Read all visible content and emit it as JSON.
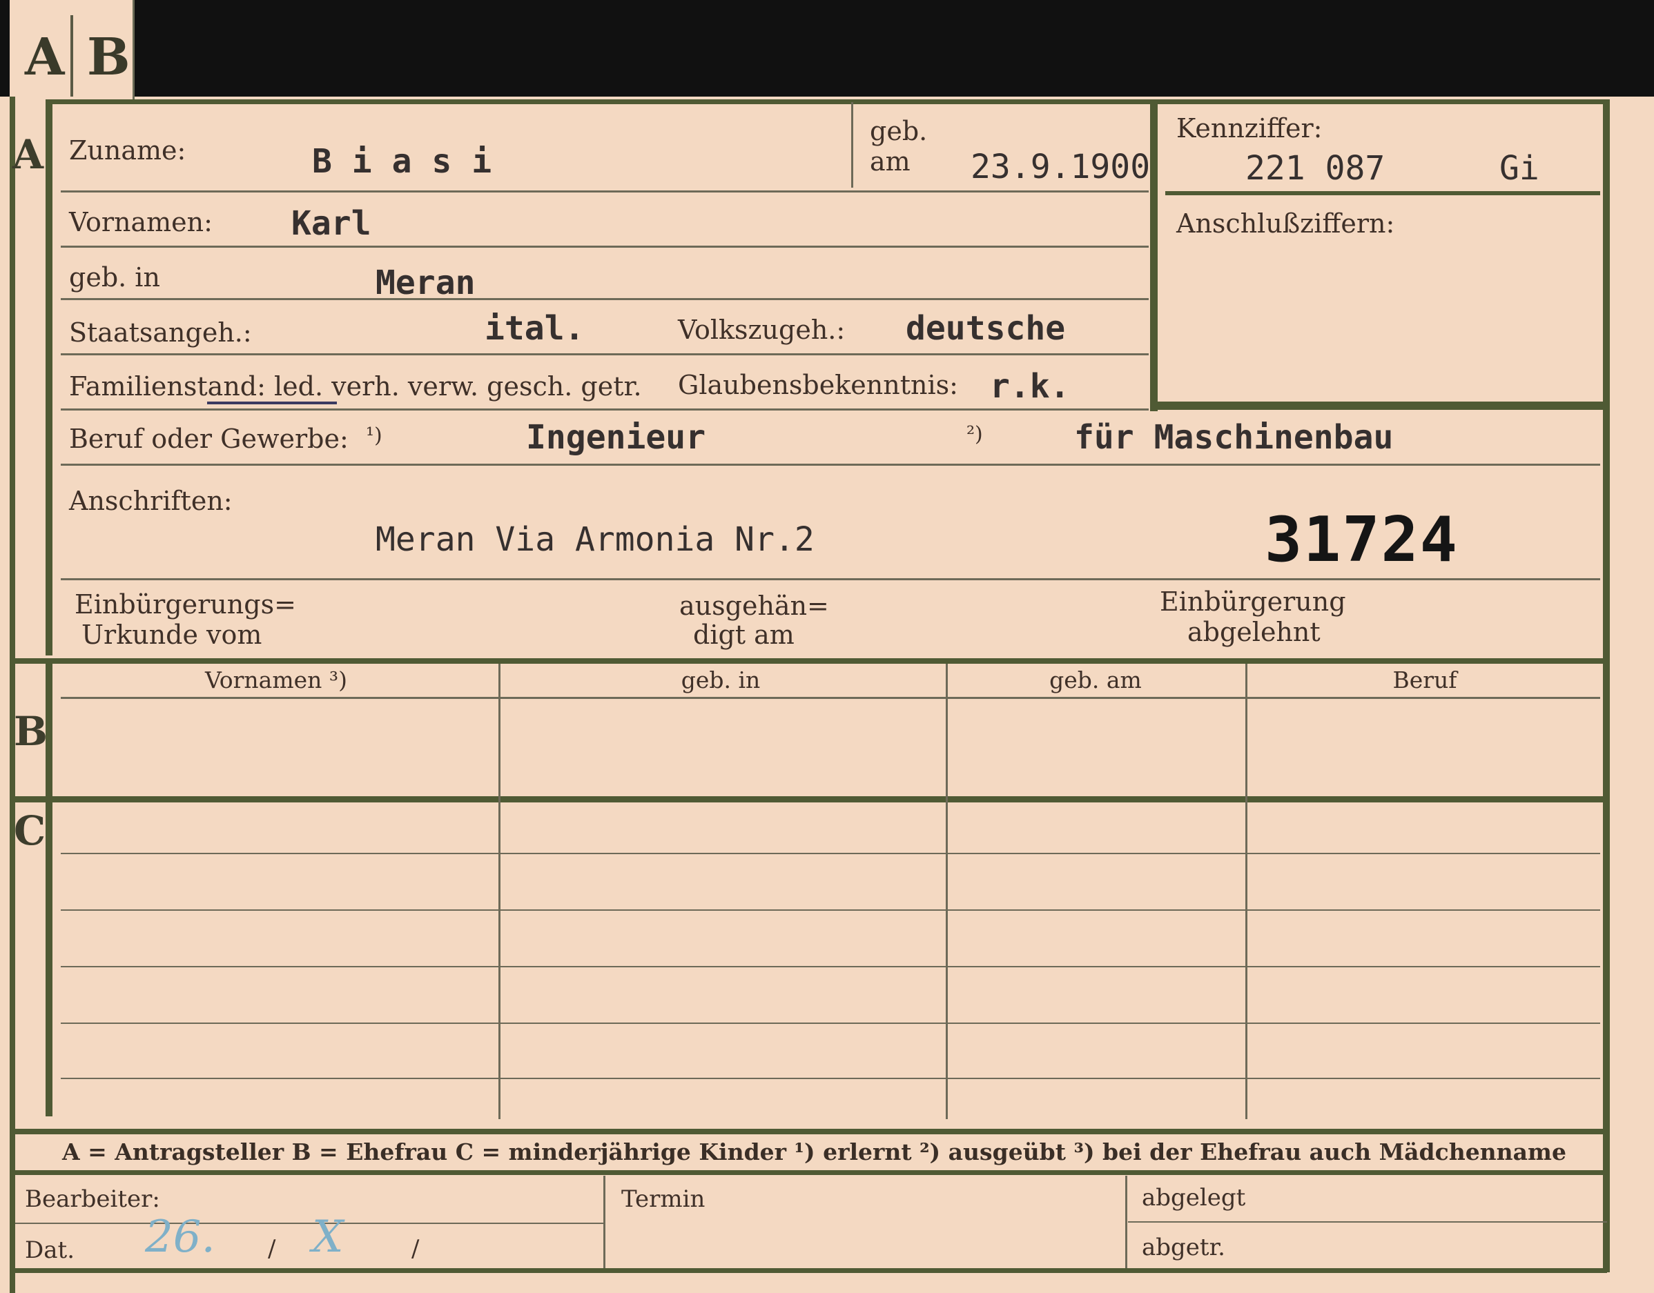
{
  "tabs": [
    "A",
    "B"
  ],
  "sections": {
    "a": "A",
    "b": "B",
    "c": "C"
  },
  "labels": {
    "zuname": "Zuname:",
    "geb_am_1": "geb.",
    "geb_am_2": "am",
    "kennziffer": "Kennziffer:",
    "vornamen": "Vornamen:",
    "anschlussziffern": "Anschlußziffern:",
    "geb_in": "geb. in",
    "staatsangeh": "Staatsangeh.:",
    "volkszugeh": "Volkszugeh.:",
    "familienstand": "Familienstand: led. verh. verw. gesch. getr.",
    "glaubensbekenntnis": "Glaubensbekenntnis:",
    "beruf": "Beruf oder Gewerbe:",
    "beruf_note1": "¹)",
    "beruf_note2": "²)",
    "anschriften": "Anschriften:",
    "einbuergerung_1": "Einbürgerungs=",
    "einbuergerung_2": "Urkunde vom",
    "ausgehaendigt_1": "ausgehän=",
    "ausgehaendigt_2": "digt am",
    "abgelehnt_1": "Einbürgerung",
    "abgelehnt_2": "abgelehnt"
  },
  "values": {
    "zuname": "B i a s i",
    "geb_am": "23.9.1900",
    "kennziffer": "221 087",
    "kennziffer_suffix": "Gi",
    "vornamen": "Karl",
    "geb_in": "Meran",
    "staatsangeh": "ital.",
    "volkszugeh": "deutsche",
    "glaubensbekenntnis": "r.k.",
    "beruf_erlernt": "Ingenieur",
    "beruf_ausgeuebt": "für Maschinenbau",
    "anschrift": "Meran Via Armonia Nr.2",
    "stamp_number": "31724"
  },
  "table_headers": [
    "Vornamen ³)",
    "geb. in",
    "geb. am",
    "Beruf"
  ],
  "footer_legend": "A = Antragsteller   B = Ehefrau   C = minderjährige Kinder   ¹) erlernt   ²) ausgeübt   ³) bei der Ehefrau auch Mädchenname",
  "bottom": {
    "bearbeiter": "Bearbeiter:",
    "dat": "Dat.",
    "dat_value_day": "26.",
    "dat_sep1": "/",
    "dat_value_month": "X",
    "dat_sep2": "/",
    "termin": "Termin",
    "abgelegt": "abgelegt",
    "abgetr": "abgetr."
  }
}
